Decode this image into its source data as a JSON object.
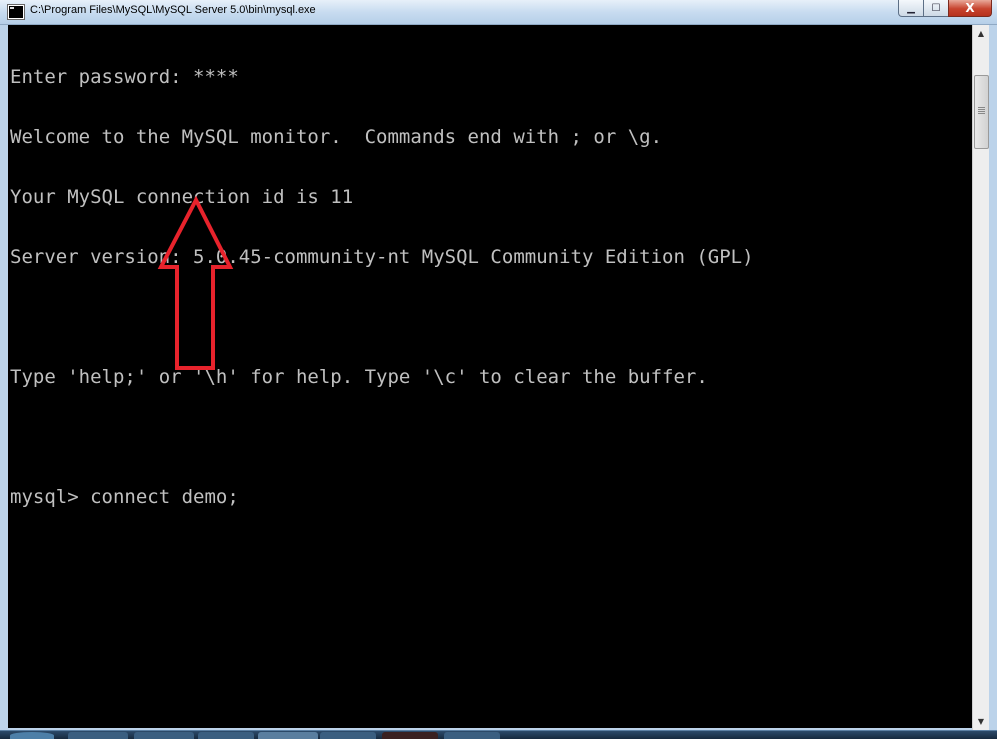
{
  "window": {
    "title": "C:\\Program Files\\MySQL\\MySQL Server 5.0\\bin\\mysql.exe",
    "caption": {
      "minimize": "▁",
      "maximize": "☐",
      "close": "X"
    }
  },
  "console": {
    "lines": [
      "Enter password: ****",
      "Welcome to the MySQL monitor.  Commands end with ; or \\g.",
      "Your MySQL connection id is 11",
      "Server version: 5.0.45-community-nt MySQL Community Edition (GPL)",
      "",
      "Type 'help;' or '\\h' for help. Type '\\c' to clear the buffer.",
      "",
      "mysql> connect demo;"
    ]
  },
  "annotation": {
    "arrow_color": "#e8232c",
    "arrow_icon": "up-arrow-icon"
  },
  "scrollbar": {
    "up_glyph": "▲",
    "down_glyph": "▼"
  },
  "colors": {
    "console_bg": "#000000",
    "console_text": "#c0c0c0"
  }
}
